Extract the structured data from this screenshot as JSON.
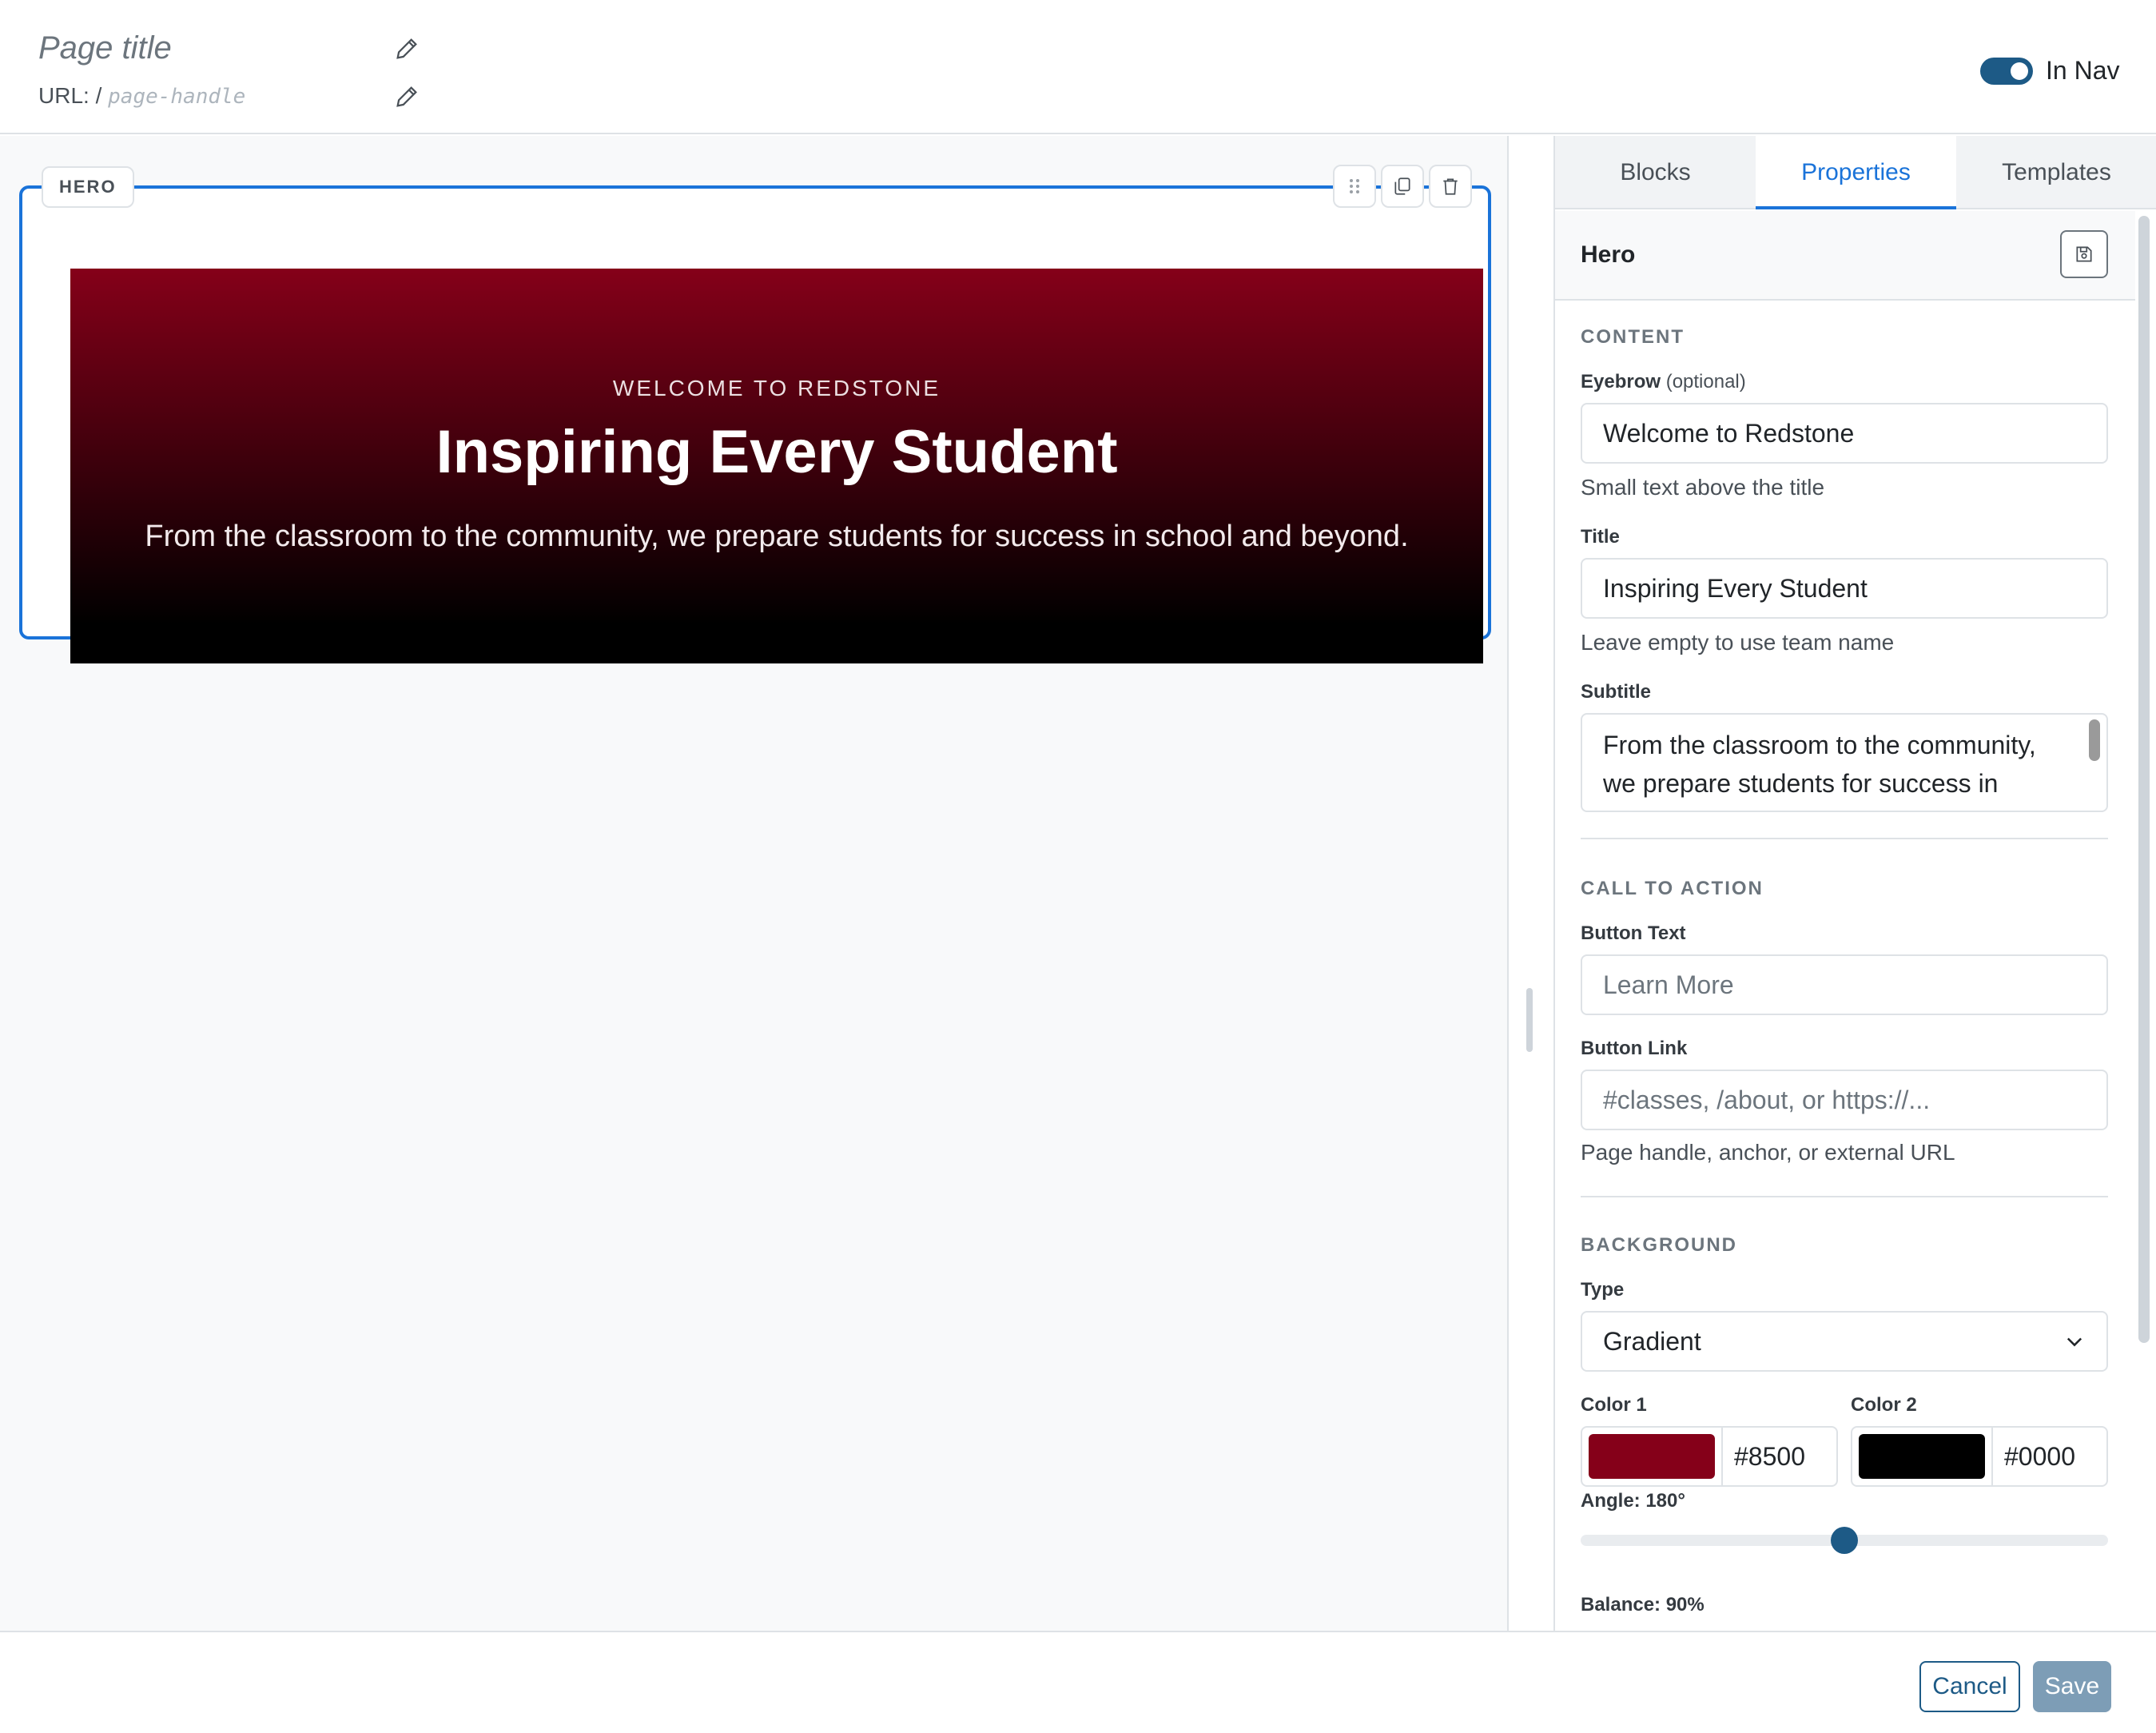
{
  "header": {
    "page_title_placeholder": "Page title",
    "url_prefix": "URL: /",
    "url_placeholder": "page-handle",
    "in_nav_label": "In Nav",
    "in_nav_on": true
  },
  "canvas": {
    "block_tag": "HERO",
    "hero": {
      "eyebrow": "WELCOME TO REDSTONE",
      "title": "Inspiring Every Student",
      "subtitle": "From the classroom to the community, we prepare students for success in school and beyond."
    }
  },
  "panel": {
    "tabs": [
      {
        "label": "Blocks",
        "active": false
      },
      {
        "label": "Properties",
        "active": true
      },
      {
        "label": "Templates",
        "active": false
      }
    ],
    "block_name": "Hero",
    "content": {
      "section_label": "CONTENT",
      "eyebrow_label": "Eyebrow",
      "eyebrow_optional": "(optional)",
      "eyebrow_value": "Welcome to Redstone",
      "eyebrow_help": "Small text above the title",
      "title_label": "Title",
      "title_value": "Inspiring Every Student",
      "title_help": "Leave empty to use team name",
      "subtitle_label": "Subtitle",
      "subtitle_value": "From the classroom to the community, we prepare students for success in"
    },
    "cta": {
      "section_label": "CALL TO ACTION",
      "button_text_label": "Button Text",
      "button_text_placeholder": "Learn More",
      "button_link_label": "Button Link",
      "button_link_placeholder": "#classes, /about, or https://...",
      "button_link_help": "Page handle, anchor, or external URL"
    },
    "background": {
      "section_label": "BACKGROUND",
      "type_label": "Type",
      "type_value": "Gradient",
      "color1_label": "Color 1",
      "color1_swatch": "#850019",
      "color1_hex": "#8500",
      "color2_label": "Color 2",
      "color2_swatch": "#000000",
      "color2_hex": "#0000",
      "angle_label": "Angle: 180°",
      "angle_value": 180,
      "angle_max": 360,
      "balance_label": "Balance: 90%"
    }
  },
  "footer": {
    "cancel_label": "Cancel",
    "save_label": "Save"
  },
  "colors": {
    "accent": "#1a73d9",
    "toggle": "#1d5a86",
    "save_disabled": "#7d9db6"
  }
}
